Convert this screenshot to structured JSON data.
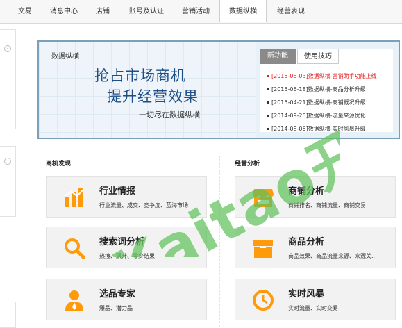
{
  "nav": {
    "tabs": [
      "交易",
      "消息中心",
      "店铺",
      "账号及认证",
      "营销活动",
      "数据纵横",
      "经营表现"
    ],
    "active": "数据纵横"
  },
  "banner": {
    "title": "数据纵横",
    "headline1": "抢占市场商机",
    "headline2": "提升经营效果",
    "subline": "一切尽在数据纵横"
  },
  "news": {
    "tab_new": "新功能",
    "tab_tips": "使用技巧",
    "items": [
      "[2015-08-03]数据纵横-营销助手功能上线",
      "[2015-06-18]数据纵横-商品分析升级",
      "[2015-04-21]数据纵横-商铺概况升级",
      "[2014-09-25]数据纵横-流量来源优化",
      "[2014-08-06]数据纵横-实时风暴升级"
    ]
  },
  "sections": {
    "left_title": "商机发现",
    "right_title": "经营分析"
  },
  "cards": {
    "industry": {
      "title": "行业情报",
      "desc": "行业流量、成交、竞争度、蓝海市场"
    },
    "search": {
      "title": "搜索词分析",
      "desc": "热搜、飙升、零少结果"
    },
    "selection": {
      "title": "选品专家",
      "desc": "爆品、潜力品"
    },
    "shop": {
      "title": "商铺分析",
      "desc": "商铺排名、商铺流量、商铺交易"
    },
    "product": {
      "title": "商品分析",
      "desc": "商品效果、商品流量来源、来源关..."
    },
    "realtime": {
      "title": "实时风暴",
      "desc": "实时流量、实时交易"
    }
  },
  "watermark": "Kaitao 开淘",
  "colors": {
    "accent_orange": "#ff9a0a",
    "banner_blue": "#1d4f86",
    "watermark_green": "#5fc15a",
    "news_red": "#e02020"
  },
  "icons": [
    "chart-bars-icon",
    "magnifier-icon",
    "person-icon",
    "storefront-icon",
    "box-icon",
    "clock-icon"
  ]
}
